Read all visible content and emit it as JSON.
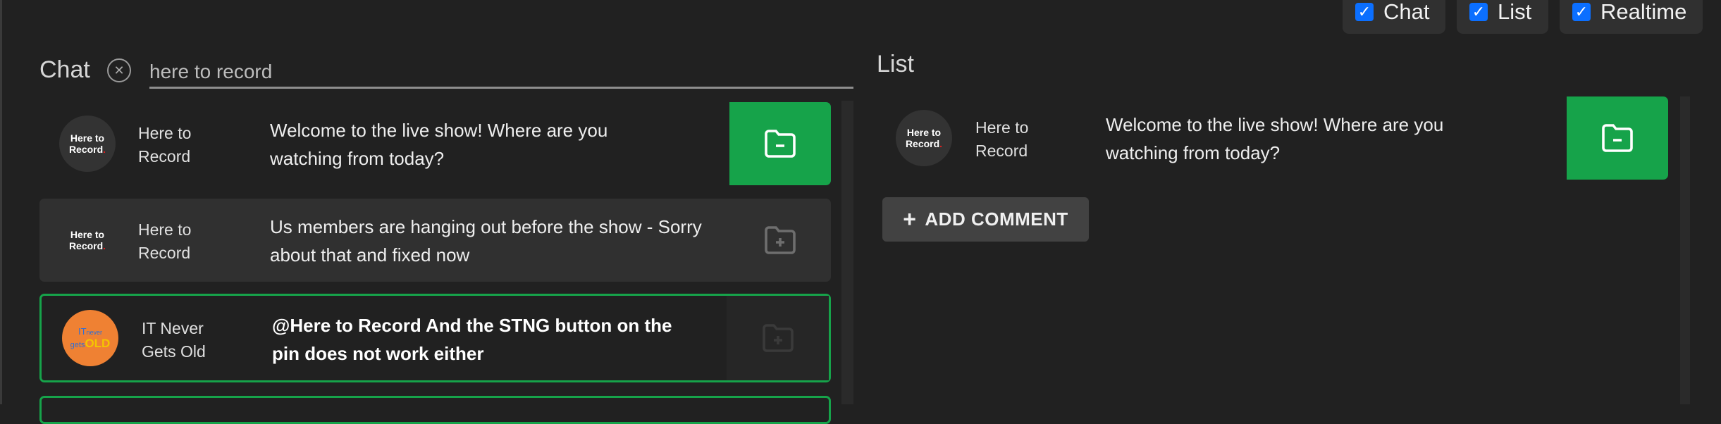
{
  "toggles": [
    {
      "label": "Chat",
      "checked": true
    },
    {
      "label": "List",
      "checked": true
    },
    {
      "label": "Realtime",
      "checked": true
    }
  ],
  "chat": {
    "title": "Chat",
    "search_value": "here to record",
    "messages": [
      {
        "author": "Here to Record",
        "avatar_text": [
          "Here to",
          "Record"
        ],
        "text": "Welcome to the live show! Where are you watching from today?",
        "state": "added",
        "action_icon": "folder-minus-icon"
      },
      {
        "author": "Here to Record",
        "avatar_text": [
          "Here to",
          "Record"
        ],
        "text": "Us members are hanging out before the show - Sorry about that and fixed now",
        "state": "hover",
        "action_icon": "folder-plus-icon"
      },
      {
        "author": "IT Never Gets Old",
        "avatar_text": [
          "IT never gets OLD"
        ],
        "text": "@Here to Record And the STNG button on the pin does not work either",
        "state": "highlighted",
        "action_icon": "folder-plus-icon"
      }
    ]
  },
  "list": {
    "title": "List",
    "items": [
      {
        "author": "Here to Record",
        "text": "Welcome to the live show! Where are you watching from today?",
        "action_icon": "folder-minus-icon"
      }
    ],
    "add_comment_label": "ADD COMMENT"
  },
  "colors": {
    "accent_green": "#16a34a",
    "checkbox_blue": "#0b6fff",
    "background": "#212121",
    "avatar_orange": "#ef8133"
  }
}
